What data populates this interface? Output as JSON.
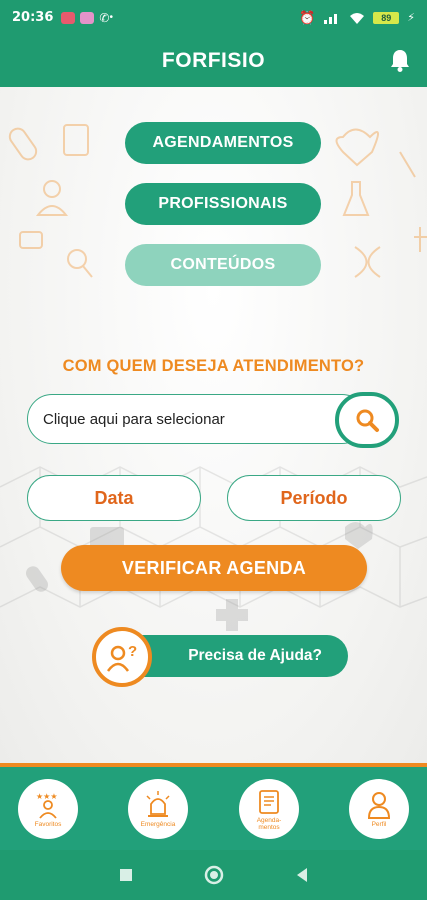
{
  "status_bar": {
    "time": "20:36",
    "battery": "89"
  },
  "header": {
    "title": "FORFISIO"
  },
  "menu": {
    "items": [
      {
        "label": "AGENDAMENTOS",
        "enabled": true
      },
      {
        "label": "PROFISSIONAIS",
        "enabled": true
      },
      {
        "label": "CONTEÚDOS",
        "enabled": false
      }
    ]
  },
  "booking": {
    "question": "COM QUEM DESEJA ATENDIMENTO?",
    "search_value": "Clique aqui para selecionar",
    "date_label": "Data",
    "period_label": "Período",
    "verify_label": "VERIFICAR AGENDA",
    "help_label": "Precisa de Ajuda?"
  },
  "bottom_nav": {
    "items": [
      {
        "label": "Favoritos",
        "icon": "favorites-person-stars-icon"
      },
      {
        "label": "Emergência",
        "icon": "siren-icon"
      },
      {
        "label": "Agendamentos",
        "label_line1": "Agenda-",
        "label_line2": "mentos",
        "icon": "schedule-list-icon"
      },
      {
        "label": "Perfil",
        "icon": "person-icon"
      }
    ]
  },
  "colors": {
    "primary_green": "#22a07a",
    "dark_green": "#1f9b70",
    "accent_orange": "#ee8a21",
    "disabled_green": "#8ed3bd"
  }
}
